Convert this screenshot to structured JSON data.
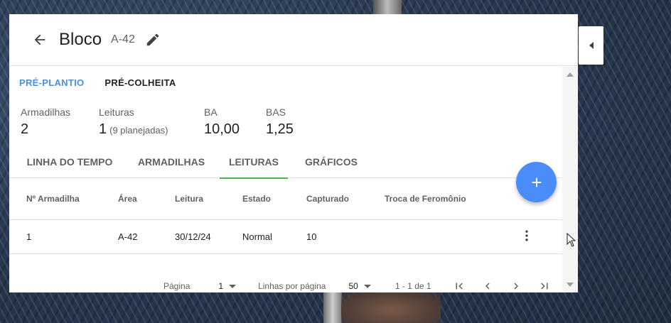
{
  "header": {
    "title": "Bloco",
    "subtitle": "A-42"
  },
  "phase_tabs": [
    {
      "label": "PRÉ-PLANTIO",
      "active": true
    },
    {
      "label": "PRÉ-COLHEITA",
      "active": false
    }
  ],
  "stats": {
    "armadilhas": {
      "label": "Armadilhas",
      "value": "2"
    },
    "leituras": {
      "label": "Leituras",
      "value": "1",
      "sub": "(9 planejadas)"
    },
    "ba": {
      "label": "BA",
      "value": "10,00"
    },
    "bas": {
      "label": "BAS",
      "value": "1,25"
    }
  },
  "view_tabs": [
    {
      "label": "LINHA DO TEMPO",
      "active": false
    },
    {
      "label": "ARMADILHAS",
      "active": false
    },
    {
      "label": "LEITURAS",
      "active": true
    },
    {
      "label": "GRÁFICOS",
      "active": false
    }
  ],
  "table": {
    "columns": [
      "Nº Armadilha",
      "Área",
      "Leitura",
      "Estado",
      "Capturado",
      "Troca de Feromônio"
    ],
    "rows": [
      [
        "1",
        "A-42",
        "30/12/24",
        "Normal",
        "10",
        ""
      ]
    ]
  },
  "pagination": {
    "page_label": "Página",
    "page_value": "1",
    "rows_label": "Linhas por página",
    "rows_value": "50",
    "range": "1 - 1 de 1"
  },
  "colors": {
    "accent": "#4a90e2",
    "tab_indicator": "#4caf50",
    "fab": "#4a8df8"
  },
  "icons": {
    "back": "arrow-left-icon",
    "edit": "pencil-icon",
    "fab": "plus-icon",
    "row_menu": "more-vertical-icon",
    "collapse": "caret-left-icon"
  }
}
